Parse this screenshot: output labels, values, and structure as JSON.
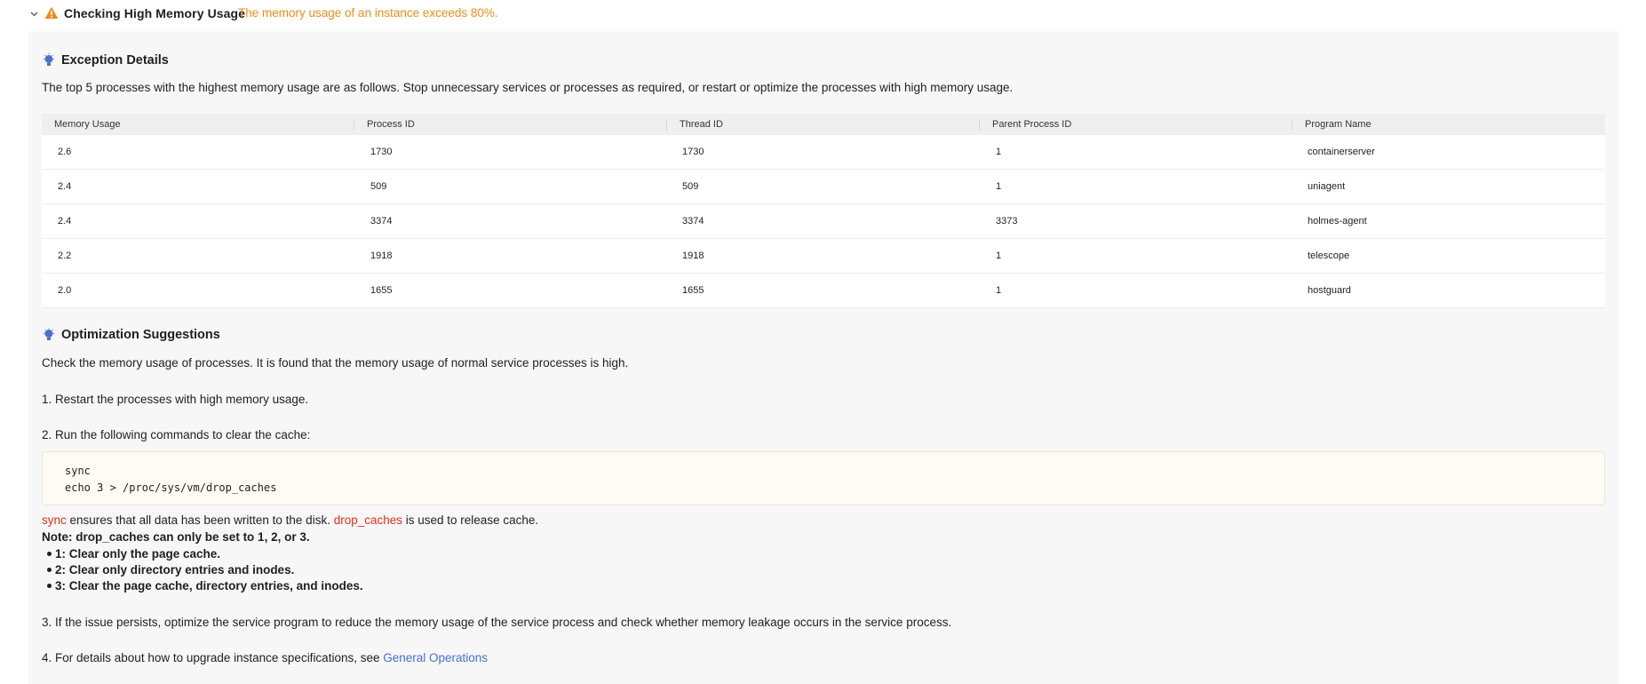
{
  "header": {
    "title": "Checking High Memory Usage",
    "description": "The memory usage of an instance exceeds 80%."
  },
  "exception": {
    "title": "Exception Details",
    "summary": "The top 5 processes with the highest memory usage are as follows. Stop unnecessary services or processes as required, or restart or optimize the processes with high memory usage."
  },
  "table": {
    "columns": [
      "Memory Usage",
      "Process ID",
      "Thread ID",
      "Parent Process ID",
      "Program Name"
    ],
    "rows": [
      [
        "2.6",
        "1730",
        "1730",
        "1",
        "containerserver"
      ],
      [
        "2.4",
        "509",
        "509",
        "1",
        "uniagent"
      ],
      [
        "2.4",
        "3374",
        "3374",
        "3373",
        "holmes-agent"
      ],
      [
        "2.2",
        "1918",
        "1918",
        "1",
        "telescope"
      ],
      [
        "2.0",
        "1655",
        "1655",
        "1",
        "hostguard"
      ]
    ]
  },
  "optimization": {
    "title": "Optimization Suggestions",
    "intro": "Check the memory usage of processes. It is found that the memory usage of normal service processes is high.",
    "step1": "1. Restart the processes with high memory usage.",
    "step2": "2. Run the following commands to clear the cache:",
    "code_line1": "sync",
    "code_line2": "echo 3 > /proc/sys/vm/drop_caches",
    "explain_sync": "sync",
    "explain_mid": " ensures that all data has been written to the disk. ",
    "explain_drop": "drop_caches",
    "explain_end": " is used to release cache.",
    "note": "Note: drop_caches can only be set to 1, 2, or 3.",
    "bullets": [
      "1: Clear only the page cache.",
      "2: Clear only directory entries and inodes.",
      "3: Clear the page cache, directory entries, and inodes."
    ],
    "step3": "3. If the issue persists, optimize the service program to reduce the memory usage of the service process and check whether memory leakage occurs in the service process.",
    "step4_prefix": "4. For details about how to upgrade instance specifications, see ",
    "step4_link": "General Operations"
  },
  "colors": {
    "warning": "#f08c1a",
    "accent": "#4a6fcf",
    "highlight": "#e0311f"
  }
}
